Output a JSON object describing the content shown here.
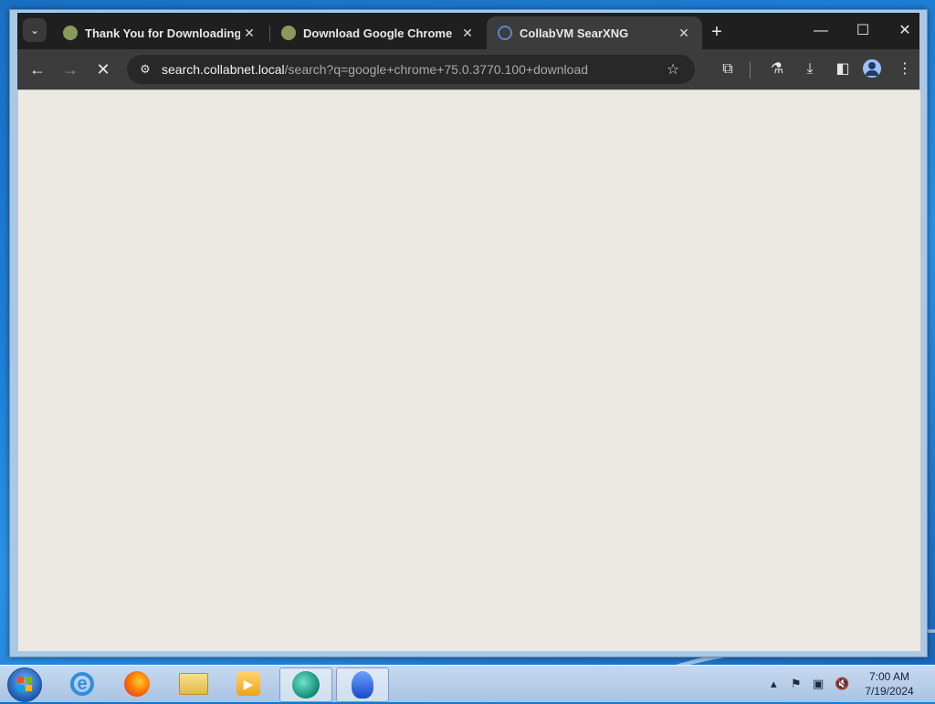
{
  "browser": {
    "tabs": [
      {
        "title": "Thank You for Downloading!",
        "favicon": "generic-site-favicon",
        "active": false
      },
      {
        "title": "Download Google Chrome",
        "favicon": "generic-site-favicon",
        "active": false
      },
      {
        "title": "CollabVM SearXNG",
        "favicon": "searxng-favicon",
        "active": true
      }
    ],
    "close_glyph": "✕",
    "new_tab_glyph": "+",
    "url_host": "search.collabnet.local",
    "url_path": "/search?q=google+chrome+75.0.3770.100+download",
    "loading": true
  },
  "taskbar": {
    "apps": [
      "internet-explorer",
      "firefox",
      "file-explorer",
      "media-player",
      "green-app",
      "blue-app"
    ],
    "active_apps": [
      "green-app",
      "blue-app"
    ]
  },
  "clock": {
    "time": "7:00 AM",
    "date": "7/19/2024"
  },
  "colors": {
    "titlebar": "#1f1f1f",
    "toolbar": "#3c3c3c",
    "content_bg": "#ece9e4",
    "desktop": "#1d7fd6"
  }
}
